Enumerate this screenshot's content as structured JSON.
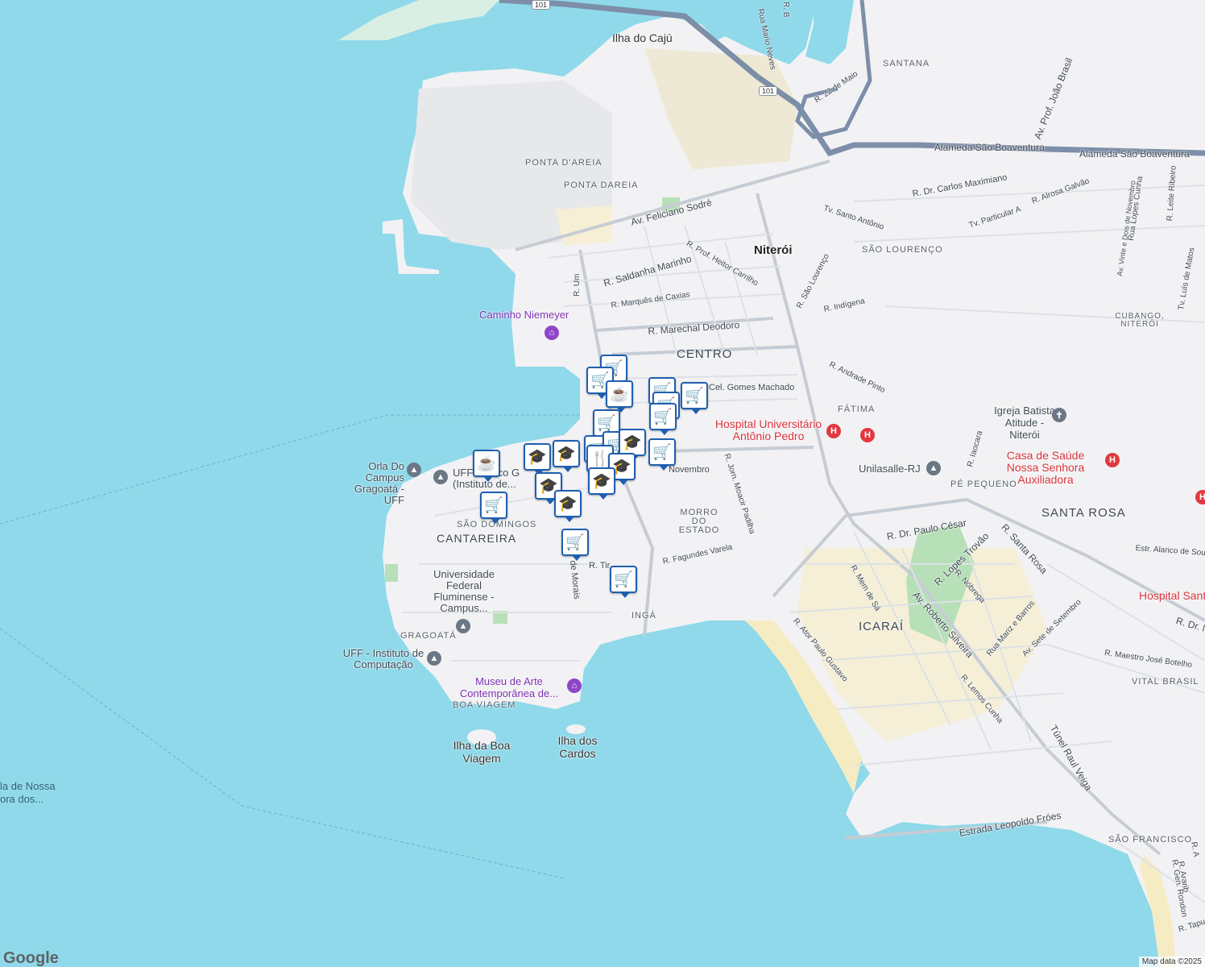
{
  "map": {
    "city": "Niterói",
    "districts": [
      "CENTRO",
      "PONTA D'AREIA",
      "PONTA DAREIA",
      "SANTANA",
      "SÃO LOURENÇO",
      "FÁTIMA",
      "PÉ PEQUENO",
      "SANTA ROSA",
      "CUBANGO, NITERÓI",
      "ICARAÍ",
      "VITAL BRASIL",
      "SÃO FRANCISCO",
      "MORRO DO ESTADO",
      "INGÁ",
      "SÃO DOMINGOS",
      "CANTAREIRA",
      "GRAGOATÁ",
      "BOA VIAGEM"
    ],
    "islands": [
      "Ilha do Cajú",
      "Ilha da Boa Viagem",
      "Ilha dos Cardos"
    ],
    "water_labels": [
      "la de Nossa",
      "ora dos..."
    ],
    "pois": {
      "caminho_niemeyer": "Caminho Niemeyer",
      "orla_campus": "Orla Do Campus Gragoatá - UFF",
      "uff_g": "UFF - Bloco G (Instituto de...",
      "universidade_federal": "Universidade Federal Fluminense - Campus...",
      "uff_computacao": "UFF - Instituto de Computação",
      "museu": "Museu de Arte Contemporânea de...",
      "hospital_antonio_pedro": "Hospital Universitário Antônio Pedro",
      "igreja": "Igreja Batista Atitude - Niterói",
      "casa_saude": "Casa de Saúde Nossa Senhora Auxiliadora",
      "unilasalle": "Unilasalle-RJ",
      "hospital_right": "Hospital Sant"
    },
    "roads": [
      "Av. Feliciano Sodré",
      "R. Saldanha Marinho",
      "R. Marquês de Caxias",
      "R. Marechal Deodoro",
      "R. Prof. Heitor Carrilho",
      "R. Um",
      "Cel. Gomes Machado",
      "Tv. Santo Antônio",
      "R. Dr. Carlos Maximiano",
      "Alameda São Boaventura",
      "Alameda São Boaventura",
      "Av. Prof. João Brasil",
      "R. 22 de Maio",
      "Rua Mario Neves",
      "R. B",
      "Tv. Particular A",
      "R. Alrosa Galvão",
      "R. São Lourenço",
      "R. Indígena",
      "R. Andrade Pinto",
      "R. Jorn. Moacir Padilha",
      "R. Fagundes Varela",
      "R. Tir...",
      "de Morais",
      "Novembro",
      "R. Dr. Paulo César",
      "R. Lopes Trovão",
      "R. Santa Rosa",
      "Av. Roberto Silveira",
      "R. Mem de Sá",
      "R. Nóbrega",
      "Rua Mariz e Barros",
      "Av. Sete de Setembro",
      "R. Ator Paulo Gustavo",
      "R. Lemos Cunha",
      "Túnel Raul Veiga",
      "Estrada Leopoldo Fróes",
      "R. Maestro José Botelho",
      "Estr. Alarico de Sou",
      "R. Dr. N",
      "R. Iaocara",
      "Av. Vinte e Dois de Novembro",
      "Rua Lopes Cunha",
      "R. Leite Ribeiro",
      "Tv. Luís de Matos",
      "R. Ararib",
      "R. Gen. Rondon",
      "R. Tapu",
      "R. A"
    ],
    "highway_shield": "101",
    "pin_types": [
      "cart",
      "cart",
      "cup",
      "cart",
      "cart",
      "cart",
      "cart",
      "cart",
      "cart",
      "cart",
      "grad",
      "grad",
      "grad",
      "fork",
      "grad",
      "cart",
      "cup",
      "grad",
      "grad",
      "grad",
      "cart",
      "cart",
      "cart"
    ]
  },
  "footer": {
    "logo": "Google",
    "attribution": "Map data ©2025"
  }
}
